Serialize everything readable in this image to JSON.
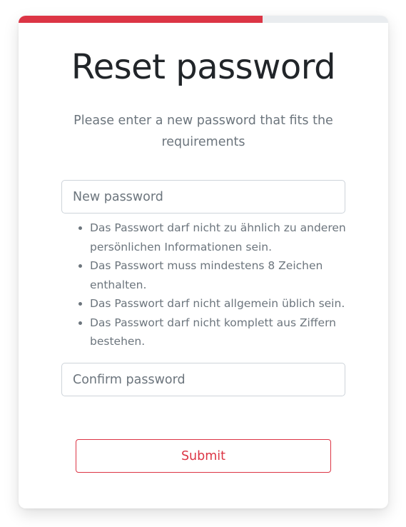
{
  "progress": {
    "fraction": 0.66,
    "fill_color": "#dc3545",
    "track_color": "#e9ecef"
  },
  "header": {
    "title": "Reset password",
    "subtitle": "Please enter a new password that fits the requirements"
  },
  "form": {
    "new_password": {
      "placeholder": "New password",
      "value": ""
    },
    "requirements": [
      "Das Passwort darf nicht zu ähnlich zu anderen persönlichen Informationen sein.",
      "Das Passwort muss mindestens 8 Zeichen enthalten.",
      "Das Passwort darf nicht allgemein üblich sein.",
      "Das Passwort darf nicht komplett aus Ziffern bestehen."
    ],
    "confirm_password": {
      "placeholder": "Confirm password",
      "value": ""
    },
    "submit_label": "Submit"
  },
  "colors": {
    "accent": "#dc3545",
    "text": "#212529",
    "muted": "#6c757d"
  }
}
